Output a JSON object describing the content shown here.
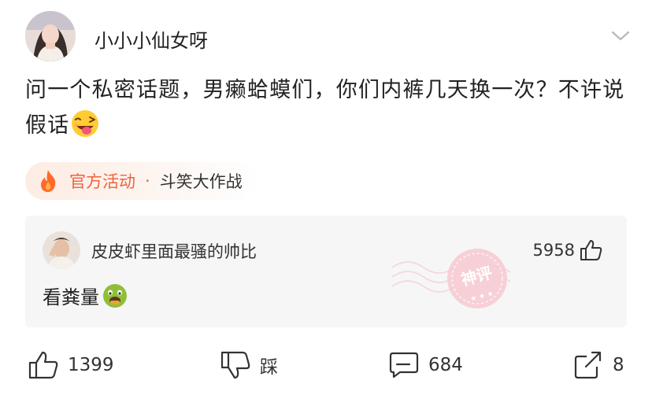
{
  "user": {
    "name": "小小小仙女呀"
  },
  "post": {
    "text": "问一个私密话题，男癞蛤蟆们，你们内裤几天换一次？不许说假话",
    "emoji": "winking-tongue-emoji"
  },
  "activity": {
    "tag": "官方活动",
    "separator": "·",
    "name": "斗笑大作战",
    "color": "#f0623e"
  },
  "top_comment": {
    "user": "皮皮虾里面最骚的帅比",
    "likes": "5958",
    "text": "看粪量",
    "emoji": "vomiting-face-emoji",
    "stamp": "神评"
  },
  "actions": {
    "likes": "1399",
    "dislike_label": "踩",
    "comments": "684",
    "shares": "8"
  }
}
